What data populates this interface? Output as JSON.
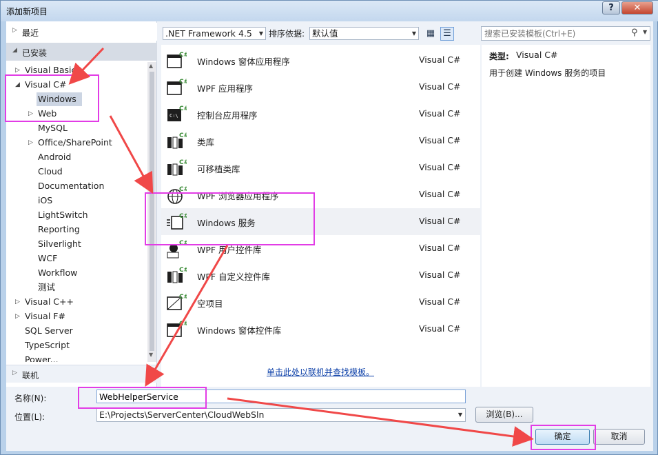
{
  "window": {
    "title": "添加新项目",
    "help_label": "?",
    "close_label": "✕"
  },
  "left": {
    "recent": "最近",
    "installed": "已安装",
    "online": "联机",
    "tree": [
      {
        "label": "Visual Basic",
        "indent": 0,
        "exp": "▷"
      },
      {
        "label": "Visual C#",
        "indent": 0,
        "exp": "◢"
      },
      {
        "label": "Windows",
        "indent": 1,
        "exp": "",
        "selected": true
      },
      {
        "label": "Web",
        "indent": 1,
        "exp": "▷"
      },
      {
        "label": "MySQL",
        "indent": 1,
        "exp": ""
      },
      {
        "label": "Office/SharePoint",
        "indent": 1,
        "exp": "▷"
      },
      {
        "label": "Android",
        "indent": 1,
        "exp": ""
      },
      {
        "label": "Cloud",
        "indent": 1,
        "exp": ""
      },
      {
        "label": "Documentation",
        "indent": 1,
        "exp": ""
      },
      {
        "label": "iOS",
        "indent": 1,
        "exp": ""
      },
      {
        "label": "LightSwitch",
        "indent": 1,
        "exp": ""
      },
      {
        "label": "Reporting",
        "indent": 1,
        "exp": ""
      },
      {
        "label": "Silverlight",
        "indent": 1,
        "exp": ""
      },
      {
        "label": "WCF",
        "indent": 1,
        "exp": ""
      },
      {
        "label": "Workflow",
        "indent": 1,
        "exp": ""
      },
      {
        "label": "测试",
        "indent": 1,
        "exp": ""
      },
      {
        "label": "Visual C++",
        "indent": 0,
        "exp": "▷"
      },
      {
        "label": "Visual F#",
        "indent": 0,
        "exp": "▷"
      },
      {
        "label": "SQL Server",
        "indent": 0,
        "exp": ""
      },
      {
        "label": "TypeScript",
        "indent": 0,
        "exp": ""
      },
      {
        "label": "Power...",
        "indent": 0,
        "exp": ""
      }
    ]
  },
  "toolbar": {
    "framework": ".NET Framework 4.5",
    "sort_label": "排序依据:",
    "sort_value": "默认值",
    "search_placeholder": "搜索已安装模板(Ctrl+E)"
  },
  "templates": [
    {
      "name": "Windows 窗体应用程序",
      "lang": "Visual C#",
      "icon": "winforms-app-icon"
    },
    {
      "name": "WPF 应用程序",
      "lang": "Visual C#",
      "icon": "wpf-app-icon"
    },
    {
      "name": "控制台应用程序",
      "lang": "Visual C#",
      "icon": "console-app-icon"
    },
    {
      "name": "类库",
      "lang": "Visual C#",
      "icon": "class-library-icon"
    },
    {
      "name": "可移植类库",
      "lang": "Visual C#",
      "icon": "portable-library-icon"
    },
    {
      "name": "WPF 浏览器应用程序",
      "lang": "Visual C#",
      "icon": "wpf-browser-icon"
    },
    {
      "name": "Windows 服务",
      "lang": "Visual C#",
      "icon": "windows-service-icon",
      "selected": true
    },
    {
      "name": "WPF 用户控件库",
      "lang": "Visual C#",
      "icon": "wpf-usercontrol-icon"
    },
    {
      "name": "WPF 自定义控件库",
      "lang": "Visual C#",
      "icon": "wpf-customcontrol-icon"
    },
    {
      "name": "空项目",
      "lang": "Visual C#",
      "icon": "empty-project-icon"
    },
    {
      "name": "Windows 窗体控件库",
      "lang": "Visual C#",
      "icon": "winforms-control-icon"
    }
  ],
  "online_link": "单击此处以联机并查找模板。",
  "description": {
    "type_label": "类型:",
    "type_value": "Visual C#",
    "text": "用于创建 Windows 服务的项目"
  },
  "bottom": {
    "name_label": "名称(N):",
    "name_value": "WebHelperService",
    "location_label": "位置(L):",
    "location_value": "E:\\Projects\\ServerCenter\\CloudWebSln",
    "browse_label": "浏览(B)...",
    "ok_label": "确定",
    "cancel_label": "取消"
  },
  "colors": {
    "annotation": "#e23ce6",
    "arrow": "#f04848",
    "accent": "#3c7fb1"
  }
}
